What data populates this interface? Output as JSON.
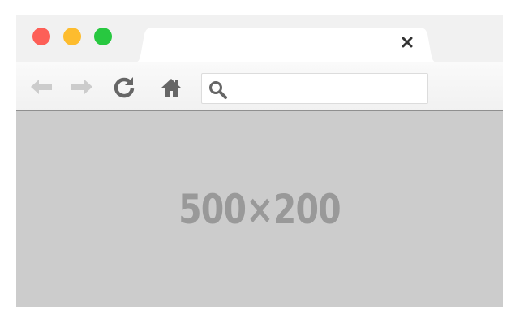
{
  "window": {
    "traffic_lights": {
      "close_color": "#fd5f57",
      "minimize_color": "#fdbc2e",
      "zoom_color": "#28c840"
    }
  },
  "tab": {
    "title": "",
    "close_icon": "close-icon"
  },
  "toolbar": {
    "back_icon": "arrow-left-icon",
    "forward_icon": "arrow-right-icon",
    "reload_icon": "reload-icon",
    "home_icon": "home-icon",
    "address": {
      "value": "",
      "placeholder": "",
      "icon": "search-icon"
    }
  },
  "content": {
    "placeholder_text": "500×200",
    "background": "#cccccc",
    "text_color": "#999999"
  }
}
